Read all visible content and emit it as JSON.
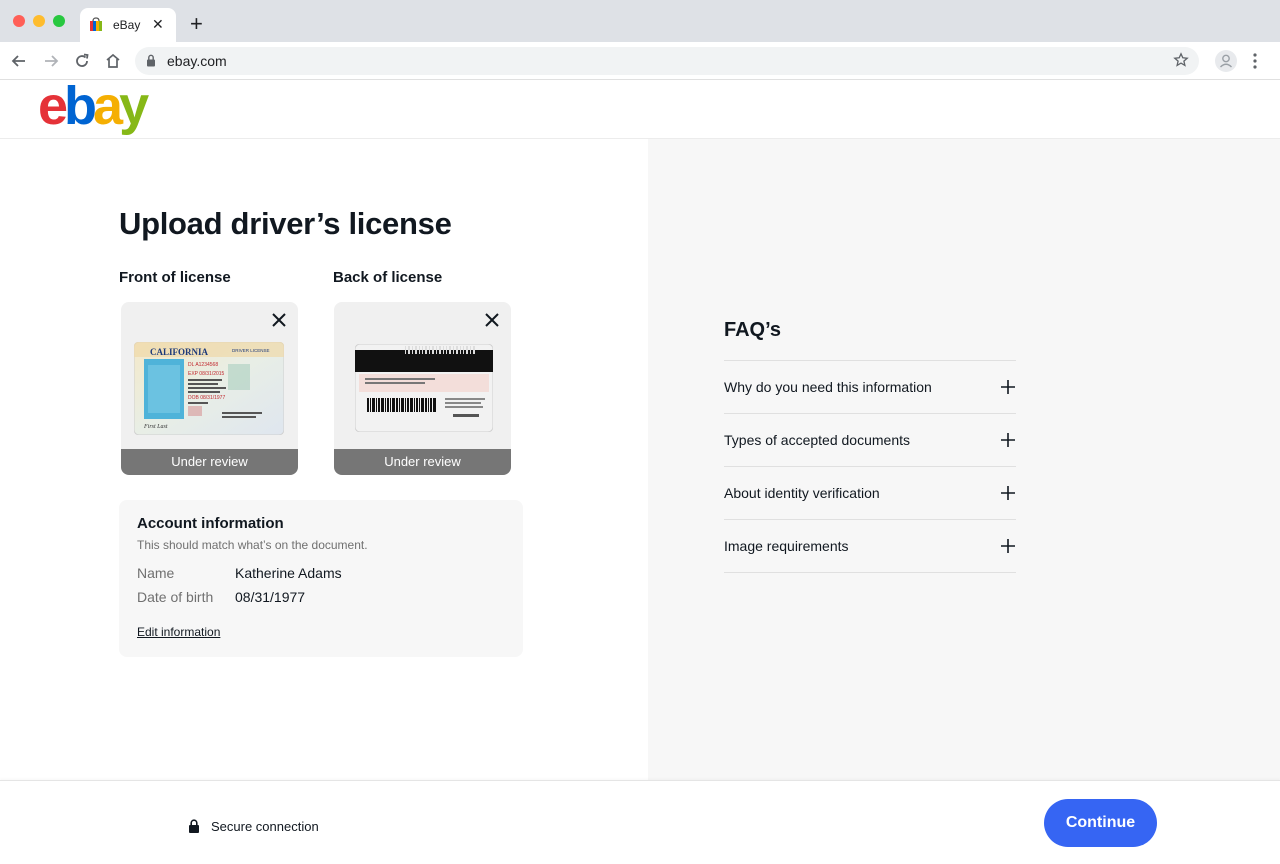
{
  "browser": {
    "tab_title": "eBay",
    "url": "ebay.com",
    "icons": [
      "back-icon",
      "forward-icon",
      "reload-icon",
      "home-icon",
      "lock-icon",
      "star-icon",
      "profile-icon",
      "menu-icon"
    ]
  },
  "header": {
    "logo_letters": [
      "e",
      "b",
      "a",
      "y"
    ],
    "logo_colors": [
      "#e53238",
      "#0064d2",
      "#f5af02",
      "#86b817"
    ]
  },
  "main": {
    "title": "Upload driver’s license",
    "front": {
      "label": "Front of license",
      "status": "Under review",
      "card_state": "CALIFORNIA",
      "card_type": "DRIVER LICENSE"
    },
    "back": {
      "label": "Back of license",
      "status": "Under review"
    },
    "account": {
      "title": "Account information",
      "subtitle": "This should match what’s on the document.",
      "name_label": "Name",
      "name_value": "Katherine Adams",
      "dob_label": "Date of birth",
      "dob_value": "08/31/1977",
      "edit_link": "Edit information"
    }
  },
  "faq": {
    "title": "FAQ’s",
    "items": [
      {
        "label": "Why do you need this information"
      },
      {
        "label": "Types of accepted documents"
      },
      {
        "label": "About identity verification"
      },
      {
        "label": "Image requirements"
      }
    ]
  },
  "footer": {
    "secure_text": "Secure connection",
    "continue_label": "Continue"
  },
  "colors": {
    "accent": "#3665f3",
    "status_bg": "#767676"
  }
}
